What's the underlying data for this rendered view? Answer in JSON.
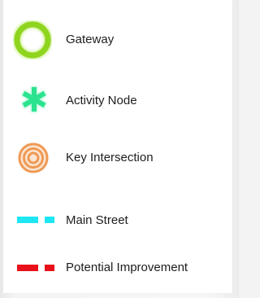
{
  "legend": {
    "items": [
      {
        "label": "Gateway",
        "icon": "gateway-ring-icon",
        "color": "#8fd41e"
      },
      {
        "label": "Activity Node",
        "icon": "activity-node-asterisk-icon",
        "color": "#2be38f"
      },
      {
        "label": "Key Intersection",
        "icon": "key-intersection-target-icon",
        "color": "#ef9a55"
      },
      {
        "label": "Main Street",
        "icon": "main-street-dashed-line-icon",
        "color": "#1ee6f2"
      },
      {
        "label": "Potential Improvement",
        "icon": "potential-improvement-dashed-line-icon",
        "color": "#e8101a"
      }
    ]
  }
}
